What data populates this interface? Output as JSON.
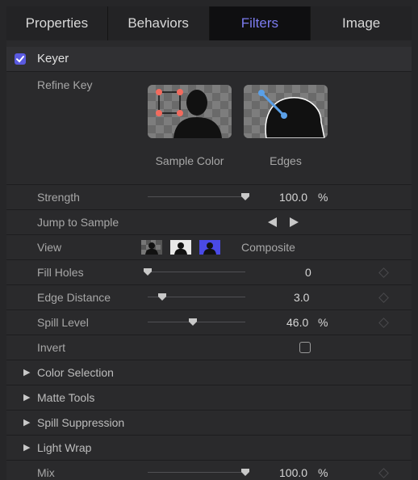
{
  "tabs": [
    "Properties",
    "Behaviors",
    "Filters",
    "Image"
  ],
  "active_tab": "Filters",
  "filter": {
    "name": "Keyer",
    "enabled": true
  },
  "refine_key": {
    "label": "Refine Key",
    "sample_color_label": "Sample Color",
    "edges_label": "Edges"
  },
  "params": {
    "strength": {
      "label": "Strength",
      "value": "100.0",
      "unit": "%",
      "slider": 1.0
    },
    "jump_to_sample": {
      "label": "Jump to Sample"
    },
    "view": {
      "label": "View",
      "value": "Composite"
    },
    "fill_holes": {
      "label": "Fill Holes",
      "value": "0",
      "unit": "",
      "slider": 0.0
    },
    "edge_distance": {
      "label": "Edge Distance",
      "value": "3.0",
      "unit": "",
      "slider": 0.15
    },
    "spill_level": {
      "label": "Spill Level",
      "value": "46.0",
      "unit": "%",
      "slider": 0.46
    },
    "invert": {
      "label": "Invert",
      "checked": false
    }
  },
  "groups": [
    "Color Selection",
    "Matte Tools",
    "Spill Suppression",
    "Light Wrap"
  ],
  "mix": {
    "label": "Mix",
    "value": "100.0",
    "unit": "%",
    "slider": 1.0
  },
  "colors": {
    "accent": "#7c7cf0",
    "checkbox": "#5a5ae0",
    "keyframe_border": "#4a4a4d"
  },
  "icons": [
    "checkbox-checked-icon",
    "sample-color-icon",
    "edges-icon",
    "previous-triangle-icon",
    "next-triangle-icon",
    "view-matte-icon",
    "view-original-icon",
    "view-composite-icon",
    "keyframe-icon",
    "disclosure-triangle-icon"
  ]
}
